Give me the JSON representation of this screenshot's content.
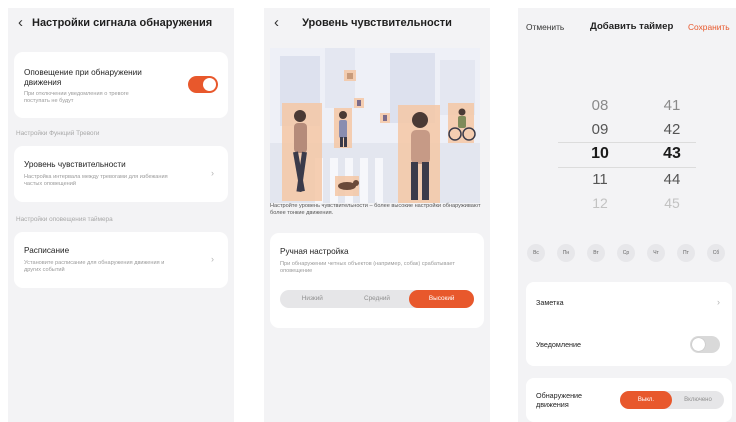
{
  "screen1": {
    "back_icon": "chevron-left-icon",
    "title": "Настройки сигнала обнаружения",
    "alert_card": {
      "title": "Оповещение при обнаружении движения",
      "desc": "При отключении уведомления о тревоге поступать не будут",
      "toggle_on": true
    },
    "section_alarm": "Настройки Функций Тревоги",
    "sensitivity_card": {
      "title": "Уровень чувствительности",
      "desc": "Настройка интервала между тревогами для избежания частых оповещений"
    },
    "section_timer": "Настройки оповещения таймера",
    "schedule_card": {
      "title": "Расписание",
      "desc": "Установите расписание для обнаружения движения и других событий"
    }
  },
  "screen2": {
    "back_icon": "chevron-left-icon",
    "title": "Уровень чувствительности",
    "caption": "Настройте уровень чувствительности – более высокие настройки обнаруживают более тонкие движения.",
    "manual": {
      "title": "Ручная настройка",
      "desc": "При обнаружении четных объектов (например, собак) срабатывает оповещение",
      "options": [
        "Низкий",
        "Средний",
        "Высокий"
      ],
      "selected": "Высокий"
    }
  },
  "screen3": {
    "cancel": "Отменить",
    "title": "Добавить таймер",
    "save": "Сохранить",
    "hours": [
      "08",
      "09",
      "10",
      "11",
      "12"
    ],
    "minutes": [
      "41",
      "42",
      "43",
      "44",
      "45"
    ],
    "selected_hour": "10",
    "selected_minute": "43",
    "days": [
      "Вс",
      "Пн",
      "Вт",
      "Ср",
      "Чт",
      "Пт",
      "Сб"
    ],
    "note_label": "Заметка",
    "notify_label": "Уведомление",
    "notify_on": false,
    "motion_label": "Обнаружение движения",
    "motion_options": [
      "Выкл.",
      "Включено"
    ],
    "motion_selected": "Выкл."
  },
  "colors": {
    "accent": "#e8582c",
    "highlight_box": "#f4c7a4",
    "background": "#f3f3f5"
  }
}
